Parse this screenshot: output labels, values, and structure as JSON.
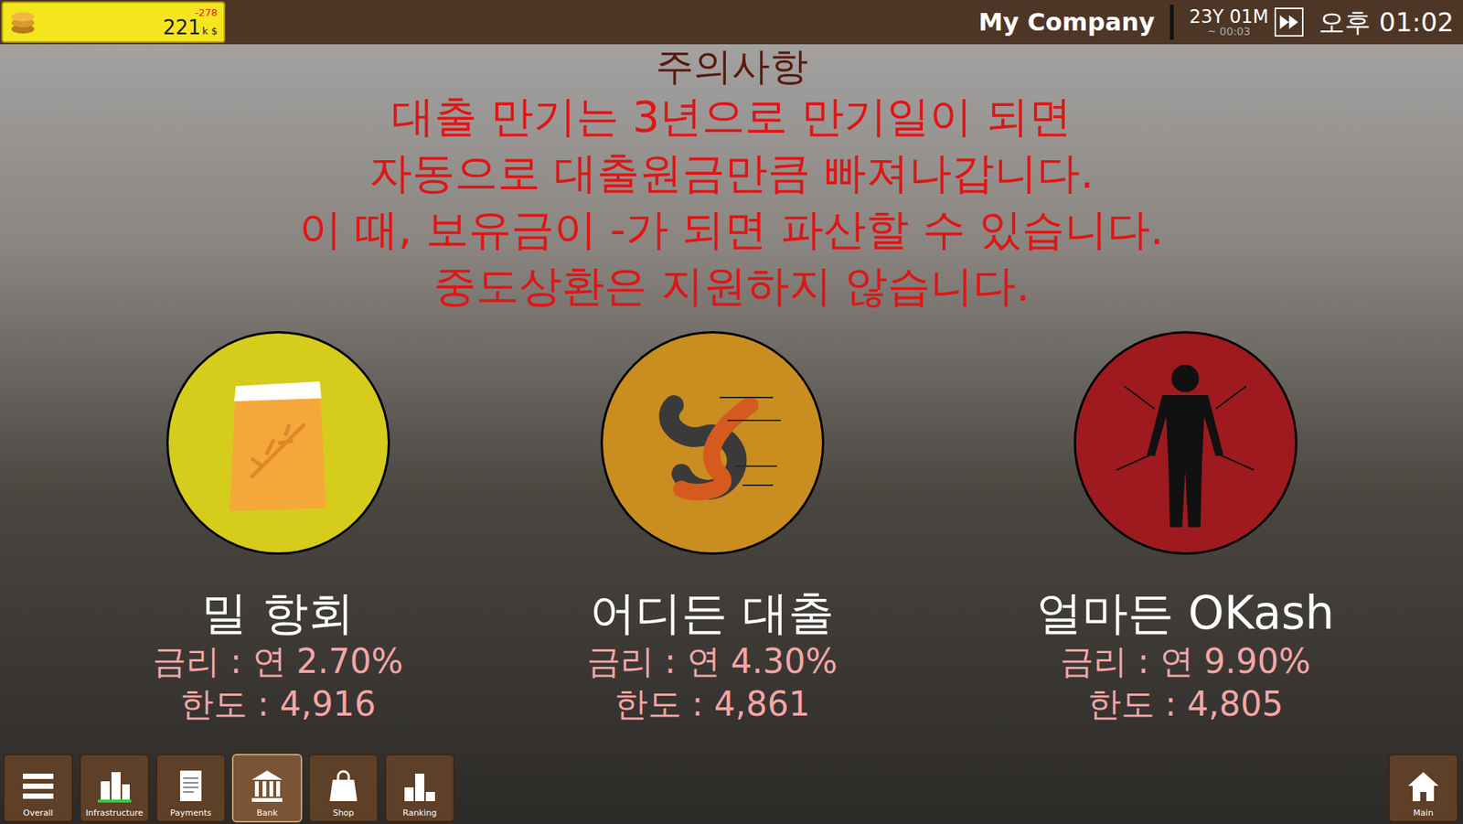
{
  "top_bar": {
    "money": "221",
    "unit": "k $",
    "delta": "-278",
    "company": "My Company",
    "date": "23Y 01M",
    "elapsed": "~ 00:03",
    "time": "오후 01:02"
  },
  "notice": {
    "title": "주의사항",
    "lines": [
      "대출 만기는 3년으로 만기일이 되면",
      "자동으로 대출원금만큼 빠져나갑니다.",
      "이 때, 보유금이 -가 되면 파산할 수 있습니다.",
      "중도상환은 지원하지 않습니다."
    ]
  },
  "lenders": [
    {
      "name": "밀 항회",
      "rate": "금리 : 연 2.70%",
      "limit": "한도 : 4,916",
      "color": "#d6cc1c"
    },
    {
      "name": "어디든 대출",
      "rate": "금리 : 연 4.30%",
      "limit": "한도 : 4,861",
      "color": "#c98e1f"
    },
    {
      "name": "얼마든 OKash",
      "rate": "금리 : 연 9.90%",
      "limit": "한도 : 4,805",
      "color": "#9e1a1f"
    }
  ],
  "nav": [
    {
      "label": "Overall",
      "selected": false
    },
    {
      "label": "Infrastructure",
      "selected": false
    },
    {
      "label": "Payments",
      "selected": false
    },
    {
      "label": "Bank",
      "selected": true
    },
    {
      "label": "Shop",
      "selected": false
    },
    {
      "label": "Ranking",
      "selected": false
    }
  ],
  "home": {
    "label": "Main"
  }
}
